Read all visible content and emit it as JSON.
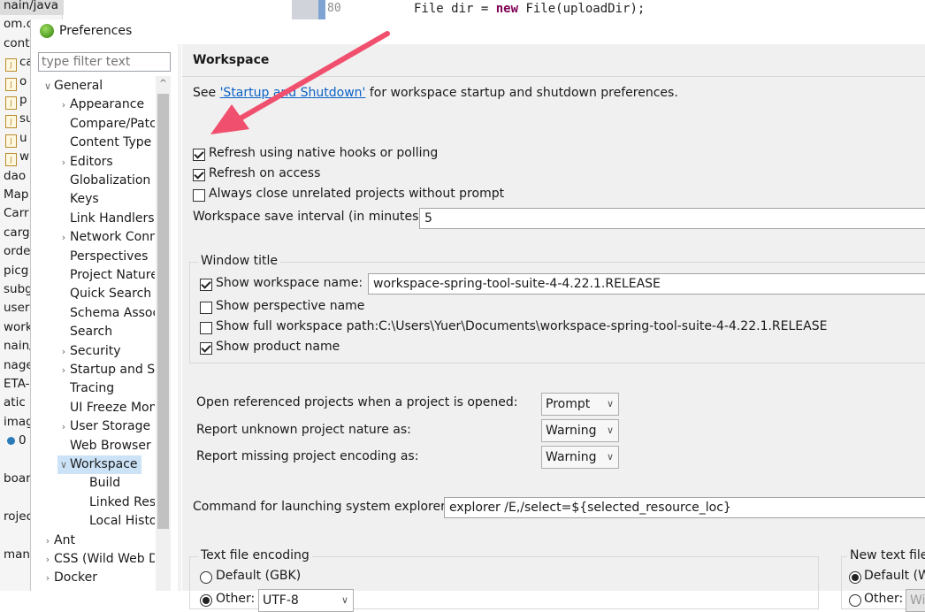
{
  "background": {
    "explorer_rows": [
      {
        "text": "nain/java",
        "icon": "",
        "sel": true
      },
      {
        "text": "om.ca",
        "icon": ""
      },
      {
        "text": "cont",
        "icon": ""
      },
      {
        "text": "ca",
        "icon": "java"
      },
      {
        "text": "o",
        "icon": "java"
      },
      {
        "text": "p",
        "icon": "java"
      },
      {
        "text": "su",
        "icon": "java"
      },
      {
        "text": "u",
        "icon": "java"
      },
      {
        "text": "w",
        "icon": "java"
      },
      {
        "text": "dao",
        "icon": ""
      },
      {
        "text": "Map",
        "icon": ""
      },
      {
        "text": "Carr",
        "icon": ""
      },
      {
        "text": "carg",
        "icon": ""
      },
      {
        "text": "orde",
        "icon": ""
      },
      {
        "text": "picg",
        "icon": ""
      },
      {
        "text": "subg",
        "icon": ""
      },
      {
        "text": "user",
        "icon": ""
      },
      {
        "text": "work",
        "icon": ""
      },
      {
        "text": "nain/r",
        "icon": ""
      },
      {
        "text": "nage",
        "icon": ""
      },
      {
        "text": "ETA-",
        "icon": ""
      },
      {
        "text": "atic",
        "icon": ""
      },
      {
        "text": "imag",
        "icon": ""
      },
      {
        "text": "0",
        "icon": "dot"
      },
      {
        "text": "",
        "icon": ""
      },
      {
        "text": "boar",
        "icon": ""
      },
      {
        "text": "",
        "icon": ""
      },
      {
        "text": "rojec",
        "icon": ""
      },
      {
        "text": "",
        "icon": ""
      },
      {
        "text": "manag",
        "icon": ""
      }
    ],
    "editor": {
      "line_number": "80",
      "code_pre": "File dir = ",
      "code_kw": "new",
      "code_post": " File(uploadDir);"
    }
  },
  "dialog": {
    "title": "Preferences",
    "filter_placeholder": "type filter text",
    "tree": [
      {
        "label": "General",
        "level": 0,
        "chev": "v"
      },
      {
        "label": "Appearance",
        "level": 1,
        "chev": ">"
      },
      {
        "label": "Compare/Patc",
        "level": 1,
        "chev": ""
      },
      {
        "label": "Content Type",
        "level": 1,
        "chev": ""
      },
      {
        "label": "Editors",
        "level": 1,
        "chev": ">"
      },
      {
        "label": "Globalization",
        "level": 1,
        "chev": ""
      },
      {
        "label": "Keys",
        "level": 1,
        "chev": ""
      },
      {
        "label": "Link Handlers",
        "level": 1,
        "chev": ""
      },
      {
        "label": "Network Conn",
        "level": 1,
        "chev": ">"
      },
      {
        "label": "Perspectives",
        "level": 1,
        "chev": ""
      },
      {
        "label": "Project Nature",
        "level": 1,
        "chev": ""
      },
      {
        "label": "Quick Search",
        "level": 1,
        "chev": ""
      },
      {
        "label": "Schema Assoc",
        "level": 1,
        "chev": ""
      },
      {
        "label": "Search",
        "level": 1,
        "chev": ""
      },
      {
        "label": "Security",
        "level": 1,
        "chev": ">"
      },
      {
        "label": "Startup and Sh",
        "level": 1,
        "chev": ">"
      },
      {
        "label": "Tracing",
        "level": 1,
        "chev": ""
      },
      {
        "label": "UI Freeze Mon",
        "level": 1,
        "chev": ""
      },
      {
        "label": "User Storage",
        "level": 1,
        "chev": ">"
      },
      {
        "label": "Web Browser",
        "level": 1,
        "chev": ""
      },
      {
        "label": "Workspace",
        "level": 1,
        "chev": "v",
        "selected": true
      },
      {
        "label": "Build",
        "level": 2,
        "chev": ""
      },
      {
        "label": "Linked Reso",
        "level": 2,
        "chev": ""
      },
      {
        "label": "Local Histo",
        "level": 2,
        "chev": ""
      },
      {
        "label": "Ant",
        "level": 0,
        "chev": ">"
      },
      {
        "label": "CSS (Wild Web D",
        "level": 0,
        "chev": ">"
      },
      {
        "label": "Docker",
        "level": 0,
        "chev": ">"
      }
    ],
    "page": {
      "title": "Workspace",
      "see_prefix": "See ",
      "see_link": "'Startup and Shutdown'",
      "see_suffix": " for workspace startup and shutdown preferences.",
      "refresh_native_label": "Refresh using native hooks or polling",
      "refresh_native_checked": true,
      "refresh_access_label": "Refresh on access",
      "refresh_access_checked": true,
      "always_close_label": "Always close unrelated projects without prompt",
      "always_close_checked": false,
      "save_interval_label": "Workspace save interval (in minutes):",
      "save_interval_value": "5",
      "window_title_group": "Window title",
      "show_ws_name_label": "Show workspace name:",
      "show_ws_name_checked": true,
      "ws_name_value": "workspace-spring-tool-suite-4-4.22.1.RELEASE",
      "show_perspective_label": "Show perspective name",
      "show_perspective_checked": false,
      "show_full_path_label": "Show full workspace path:",
      "show_full_path_checked": false,
      "full_path_value": "C:\\Users\\Yuer\\Documents\\workspace-spring-tool-suite-4-4.22.1.RELEASE",
      "show_product_label": "Show product name",
      "show_product_checked": true,
      "open_ref_label": "Open referenced projects when a project is opened:",
      "open_ref_value": "Prompt",
      "unknown_nature_label": "Report unknown project nature as:",
      "unknown_nature_value": "Warning",
      "missing_encoding_label": "Report missing project encoding as:",
      "missing_encoding_value": "Warning",
      "explorer_cmd_label": "Command for launching system explorer:",
      "explorer_cmd_value": "explorer /E,/select=${selected_resource_loc}",
      "text_encoding_group": "Text file encoding",
      "default_enc_label": "Default (GBK)",
      "other_enc_label": "Other:",
      "other_enc_value": "UTF-8",
      "new_text_group": "New text file",
      "new_default_label": "Default (W",
      "new_other_label": "Other:",
      "new_other_value": "Wi"
    }
  },
  "colors": {
    "pointer_arrow": "#f0506e",
    "link": "#0b62c7",
    "selection": "#cce3f7"
  }
}
